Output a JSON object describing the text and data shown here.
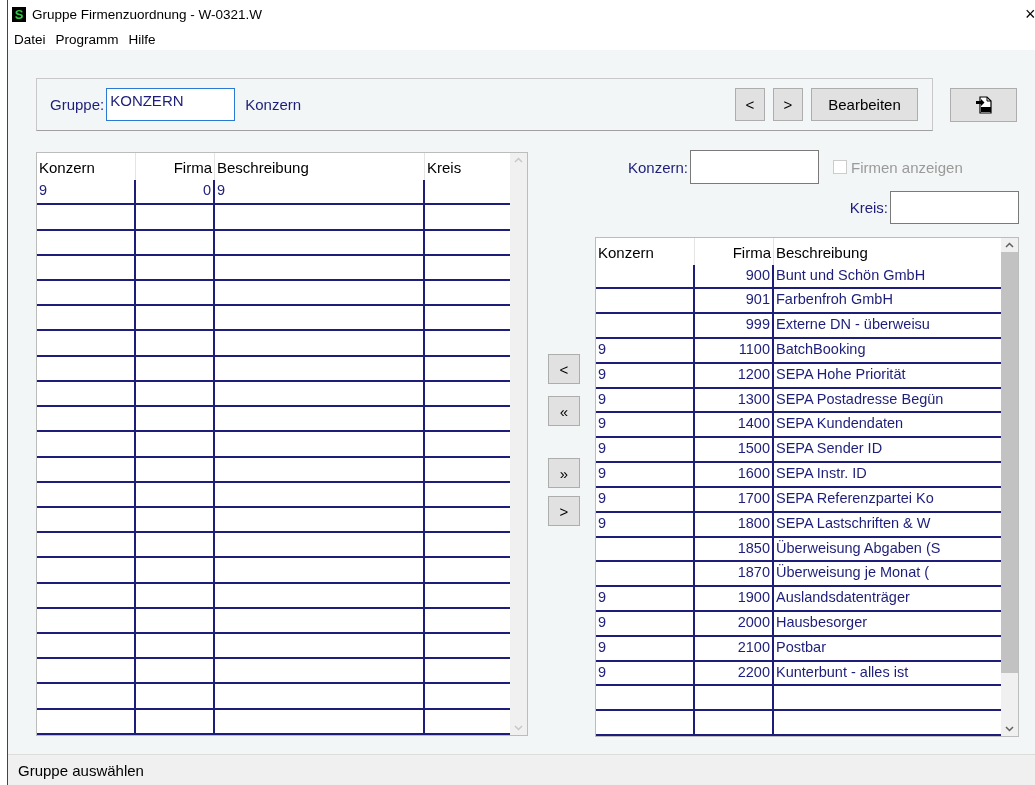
{
  "window": {
    "icon_letter": "S",
    "title": "Gruppe Firmenzuordnung - W-0321.W",
    "close": "×"
  },
  "menu": [
    {
      "label": "Datei"
    },
    {
      "label": "Programm"
    },
    {
      "label": "Hilfe"
    }
  ],
  "group_bar": {
    "label": "Gruppe:",
    "value": "KONZERN",
    "focused": true,
    "description": "Konzern",
    "buttons": [
      "<",
      ">",
      "Bearbeiten"
    ]
  },
  "left_table": {
    "columns": [
      "Konzern",
      "Firma",
      "Beschreibung",
      "Kreis"
    ],
    "rows": [
      {
        "konzern": "9",
        "firma": "0",
        "beschreibung": "9"
      }
    ]
  },
  "move_buttons": [
    "<",
    "«",
    "»",
    ">"
  ],
  "filter": {
    "konzern_label": "Konzern:",
    "kreis_label": "Kreis:",
    "checkbox": {
      "label": "Firmen anzeigen",
      "checked": false,
      "disabled": true
    }
  },
  "right_table": {
    "columns": [
      "Konzern",
      "Firma",
      "Beschreibung"
    ],
    "rows": [
      {
        "firma": "900",
        "beschreibung": "Bunt und Schön GmbH"
      },
      {
        "firma": "901",
        "beschreibung": "Farbenfroh GmbH"
      },
      {
        "firma": "999",
        "beschreibung": "Externe DN - überweisu"
      },
      {
        "konzern": "9",
        "firma": "1100",
        "beschreibung": "BatchBooking"
      },
      {
        "konzern": "9",
        "firma": "1200",
        "beschreibung": "SEPA Hohe Priorität"
      },
      {
        "konzern": "9",
        "firma": "1300",
        "beschreibung": "SEPA Postadresse Begün"
      },
      {
        "konzern": "9",
        "firma": "1400",
        "beschreibung": "SEPA Kundendaten"
      },
      {
        "konzern": "9",
        "firma": "1500",
        "beschreibung": "SEPA Sender ID"
      },
      {
        "konzern": "9",
        "firma": "1600",
        "beschreibung": "SEPA Instr. ID"
      },
      {
        "konzern": "9",
        "firma": "1700",
        "beschreibung": "SEPA Referenzpartei Ko"
      },
      {
        "konzern": "9",
        "firma": "1800",
        "beschreibung": "SEPA Lastschriften & W"
      },
      {
        "firma": "1850",
        "beschreibung": "Überweisung Abgaben (S"
      },
      {
        "firma": "1870",
        "beschreibung": "Überweisung je Monat ("
      },
      {
        "konzern": "9",
        "firma": "1900",
        "beschreibung": "Auslandsdatenträger"
      },
      {
        "konzern": "9",
        "firma": "2000",
        "beschreibung": "Hausbesorger"
      },
      {
        "konzern": "9",
        "firma": "2100",
        "beschreibung": "Postbar"
      },
      {
        "konzern": "9",
        "firma": "2200",
        "beschreibung": "Kunterbunt - alles ist"
      }
    ]
  },
  "status_bar": "Gruppe auswählen"
}
